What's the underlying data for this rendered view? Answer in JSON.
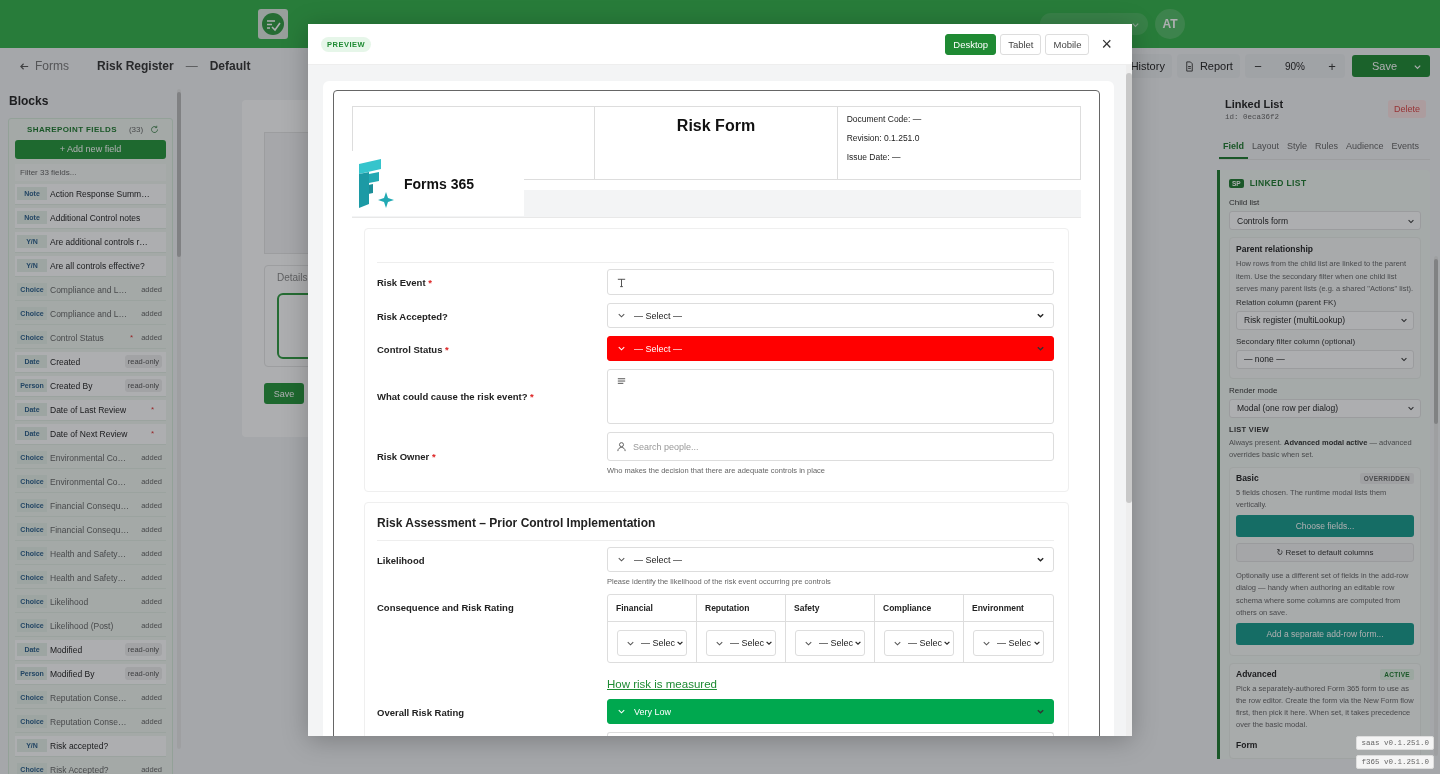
{
  "topbar": {
    "avatar": "AT"
  },
  "breadcrumb": {
    "back": "Forms",
    "form": "Risk Register",
    "separator": "—",
    "view": "Default"
  },
  "toolbar": {
    "history": "History",
    "report": "Report",
    "zoom_out": "−",
    "zoom": "90%",
    "zoom_in": "+",
    "save": "Save"
  },
  "sidebar": {
    "title": "Blocks",
    "section": "SHAREPOINT FIELDS",
    "count": "(33)",
    "add_button": "+ Add new field",
    "filter_placeholder": "Filter 33 fields...",
    "required_mark": "*",
    "fields": [
      {
        "type": "Note",
        "name": "Action Response Summ…",
        "required": false,
        "disabled": false
      },
      {
        "type": "Note",
        "name": "Additional Control notes",
        "required": false,
        "disabled": false
      },
      {
        "type": "Y/N",
        "name": "Are additional controls r…",
        "required": false,
        "disabled": false
      },
      {
        "type": "Y/N",
        "name": "Are all controls effective?",
        "required": false,
        "disabled": false
      },
      {
        "type": "Choice",
        "name": "Compliance and L…",
        "tag": "added",
        "required": false,
        "disabled": true
      },
      {
        "type": "Choice",
        "name": "Compliance and L…",
        "tag": "added",
        "required": false,
        "disabled": true
      },
      {
        "type": "Choice",
        "name": "Control Status",
        "tag": "added",
        "required": true,
        "disabled": true
      },
      {
        "type": "Date",
        "name": "Created",
        "tag": "read-only",
        "required": false,
        "disabled": false
      },
      {
        "type": "Person",
        "name": "Created By",
        "tag": "read-only",
        "required": false,
        "disabled": false
      },
      {
        "type": "Date",
        "name": "Date of Last Review",
        "required": true,
        "disabled": false
      },
      {
        "type": "Date",
        "name": "Date of Next Review",
        "required": true,
        "disabled": false
      },
      {
        "type": "Choice",
        "name": "Environmental Co…",
        "tag": "added",
        "required": false,
        "disabled": true
      },
      {
        "type": "Choice",
        "name": "Environmental Co…",
        "tag": "added",
        "required": false,
        "disabled": true
      },
      {
        "type": "Choice",
        "name": "Financial Consequ…",
        "tag": "added",
        "required": false,
        "disabled": true
      },
      {
        "type": "Choice",
        "name": "Financial Consequ…",
        "tag": "added",
        "required": false,
        "disabled": true
      },
      {
        "type": "Choice",
        "name": "Health and Safety…",
        "tag": "added",
        "required": false,
        "disabled": true
      },
      {
        "type": "Choice",
        "name": "Health and Safety…",
        "tag": "added",
        "required": false,
        "disabled": true
      },
      {
        "type": "Choice",
        "name": "Likelihood",
        "tag": "added",
        "required": false,
        "disabled": true
      },
      {
        "type": "Choice",
        "name": "Likelihood (Post)",
        "tag": "added",
        "required": false,
        "disabled": true
      },
      {
        "type": "Date",
        "name": "Modified",
        "tag": "read-only",
        "required": false,
        "disabled": false
      },
      {
        "type": "Person",
        "name": "Modified By",
        "tag": "read-only",
        "required": false,
        "disabled": false
      },
      {
        "type": "Choice",
        "name": "Reputation Conse…",
        "tag": "added",
        "required": false,
        "disabled": true
      },
      {
        "type": "Choice",
        "name": "Reputation Conse…",
        "tag": "added",
        "required": false,
        "disabled": true
      },
      {
        "type": "Y/N",
        "name": "Risk accepted?",
        "required": false,
        "disabled": false
      },
      {
        "type": "Choice",
        "name": "Risk Accepted?",
        "tag": "added",
        "required": false,
        "disabled": true
      }
    ]
  },
  "canvas": {
    "tab": "Details",
    "save": "Save"
  },
  "inspector": {
    "title": "Linked List",
    "id": "id: 0eca36f2",
    "delete": "Delete",
    "tabs": [
      {
        "label": "Field",
        "selected": true
      },
      {
        "label": "Layout",
        "selected": false
      },
      {
        "label": "Style",
        "selected": false
      },
      {
        "label": "Rules",
        "selected": false
      },
      {
        "label": "Audience",
        "selected": false
      },
      {
        "label": "Events",
        "selected": false
      }
    ],
    "section_badge": "SP",
    "section_title": "LINKED LIST",
    "child_list": {
      "label": "Child list",
      "value": "Controls form"
    },
    "parent": {
      "title": "Parent relationship",
      "description": "How rows from the child list are linked to the parent item. Use the secondary filter when one child list serves many parent lists (e.g. a shared \"Actions\" list).",
      "relation": {
        "label": "Relation column (parent FK)",
        "value": "Risk register (multiLookup)"
      },
      "secondary": {
        "label": "Secondary filter column (optional)",
        "value": "— none —"
      }
    },
    "render_mode": {
      "label": "Render mode",
      "value": "Modal (one row per dialog)"
    },
    "list_view": {
      "title": "LIST VIEW",
      "note": "Always present. **Advanced modal active** — advanced overrides basic when set.",
      "basic": {
        "title": "Basic",
        "status": "OVERRIDDEN",
        "active": false,
        "description": "5 fields chosen. The runtime modal lists them vertically.",
        "choose": "Choose fields...",
        "reset": "↻ Reset to default columns",
        "note": "Optionally use a different set of fields in the add-row dialog — handy when authoring an editable row schema where some columns are computed from others on save.",
        "add": "Add a separate add-row form..."
      },
      "advanced": {
        "title": "Advanced",
        "status": "ACTIVE",
        "active": true,
        "description": "Pick a separately-authored Form 365 form to use as the row editor. Create the form via the New Form flow first, then pick it here. When set, it takes precedence over the basic modal.",
        "field_label": "Form"
      }
    }
  },
  "preview": {
    "badge": "PREVIEW",
    "close": "×",
    "devices": [
      {
        "label": "Desktop",
        "selected": true
      },
      {
        "label": "Tablet",
        "selected": false
      },
      {
        "label": "Mobile",
        "selected": false
      }
    ],
    "form": {
      "title": "Risk Form",
      "meta": [
        "Document Code: —",
        "Revision: 0.1.251.0",
        "Issue Date: —"
      ],
      "logo_text": "Forms 365",
      "required_mark": "*",
      "sections": [
        {
          "fields": [
            {
              "kind": "text",
              "label": "Risk Event",
              "required": true
            },
            {
              "kind": "select",
              "label": "Risk Accepted?",
              "required": false,
              "value": "— Select —"
            },
            {
              "kind": "select",
              "label": "Control Status",
              "required": true,
              "value": "— Select —",
              "color": "#ff0000"
            },
            {
              "kind": "textarea",
              "label": "What could cause the risk event?",
              "required": true
            },
            {
              "kind": "people",
              "label": "Risk Owner",
              "required": true,
              "placeholder": "Search people...",
              "help": "Who makes the decision that there are adequate controls in place"
            }
          ]
        },
        {
          "title": "Risk Assessment – Prior Control Implementation",
          "fields": [
            {
              "kind": "select",
              "label": "Likelihood",
              "required": false,
              "value": "— Select —",
              "help": "Please identify the likelihood of the risk event occurring pre controls"
            },
            {
              "kind": "grid",
              "label": "Consequence and Risk Rating",
              "required": false,
              "link": "How risk is measured",
              "columns": [
                {
                  "name": "Financial",
                  "value": "— Selec"
                },
                {
                  "name": "Reputation",
                  "value": "— Selec"
                },
                {
                  "name": "Safety",
                  "value": "— Selec"
                },
                {
                  "name": "Compliance",
                  "value": "— Selec"
                },
                {
                  "name": "Environment",
                  "value": "— Selec"
                }
              ]
            },
            {
              "kind": "select",
              "label": "Overall Risk Rating",
              "required": false,
              "value": "Very Low",
              "color": "#00a84f"
            }
          ]
        }
      ]
    }
  },
  "versions": [
    "saas v0.1.251.0",
    "f365 v0.1.251.0"
  ]
}
